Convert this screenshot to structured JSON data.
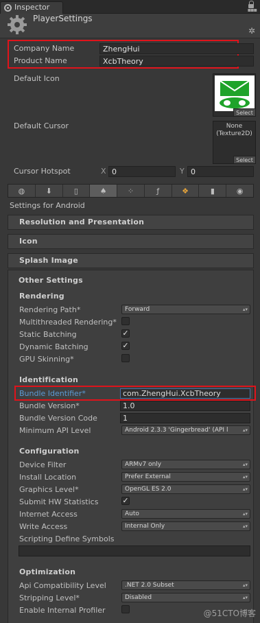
{
  "window": {
    "tab_label": "Inspector",
    "header_title": "PlayerSettings"
  },
  "fields": {
    "company_label": "Company Name",
    "company_value": "ZhengHui",
    "product_label": "Product Name",
    "product_value": "XcbTheory",
    "default_icon_label": "Default Icon",
    "icon_select": "Select",
    "default_cursor_label": "Default Cursor",
    "cursor_thumb": "None\n(Texture2D)",
    "cursor_select": "Select",
    "hotspot_label": "Cursor Hotspot",
    "hotspot_x_label": "X",
    "hotspot_x": "0",
    "hotspot_y_label": "Y",
    "hotspot_y": "0"
  },
  "platforms": [
    "web-icon",
    "download-icon",
    "phone-icon",
    "android-icon",
    "blackberry-icon",
    "flash-icon",
    "windows-icon",
    "device-icon",
    "circle-icon"
  ],
  "settings_for": "Settings for Android",
  "sections": {
    "resolution": "Resolution and Presentation",
    "icon": "Icon",
    "splash": "Splash Image",
    "other": "Other Settings"
  },
  "rendering": {
    "title": "Rendering",
    "path_label": "Rendering Path*",
    "path_value": "Forward",
    "mt_label": "Multithreaded Rendering*",
    "static_label": "Static Batching",
    "dynamic_label": "Dynamic Batching",
    "gpu_label": "GPU Skinning*"
  },
  "identification": {
    "title": "Identification",
    "bundle_id_label": "Bundle Identifier*",
    "bundle_id_value": "com.ZhengHui.XcbTheory",
    "bundle_ver_label": "Bundle Version*",
    "bundle_ver_value": "1.0",
    "bundle_code_label": "Bundle Version Code",
    "bundle_code_value": "1",
    "min_api_label": "Minimum API Level",
    "min_api_value": "Android 2.3.3 'Gingerbread' (API l"
  },
  "configuration": {
    "title": "Configuration",
    "device_filter_label": "Device Filter",
    "device_filter_value": "ARMv7 only",
    "install_label": "Install Location",
    "install_value": "Prefer External",
    "graphics_label": "Graphics Level*",
    "graphics_value": "OpenGL ES 2.0",
    "hw_stats_label": "Submit HW Statistics",
    "internet_label": "Internet Access",
    "internet_value": "Auto",
    "write_label": "Write Access",
    "write_value": "Internal Only",
    "scripting_label": "Scripting Define Symbols"
  },
  "optimization": {
    "title": "Optimization",
    "api_compat_label": "Api Compatibility Level",
    "api_compat_value": ".NET 2.0 Subset",
    "stripping_label": "Stripping Level*",
    "stripping_value": "Disabled",
    "profiler_label": "Enable Internal Profiler"
  },
  "checks": {
    "mt": false,
    "static": true,
    "dynamic": true,
    "gpu": false,
    "hw_stats": true,
    "profiler": false
  },
  "check_glyph": "✓",
  "dropdown_arrow": "▴▾",
  "watermark": "@51CTO博客",
  "colors": {
    "highlight": "#e0131b",
    "accent_blue": "#5b9bd5"
  }
}
